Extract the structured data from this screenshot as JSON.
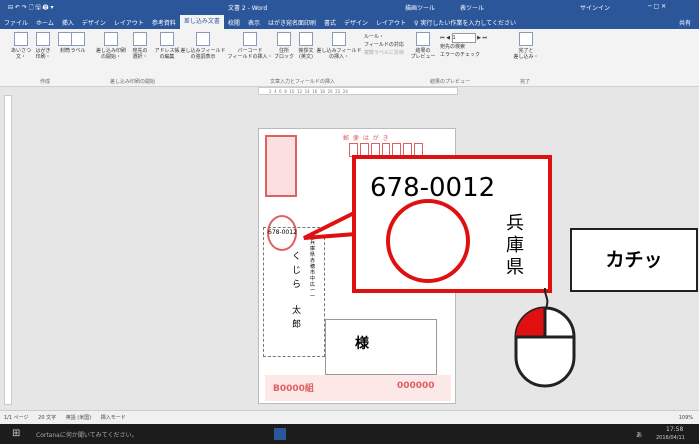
{
  "title_bar": {
    "qat": "⊟ ↶ ↷ 🗋 🖫 🖨 ▾",
    "doc_title": "文書 2 - Word",
    "context1": "描画ツール",
    "context2": "表ツール",
    "signin": "サインイン",
    "window_ctrls": "─ □ ✕"
  },
  "tabs": [
    "ファイル",
    "ホーム",
    "挿入",
    "デザイン",
    "レイアウト",
    "参考資料",
    "差し込み文書",
    "校閲",
    "表示",
    "はがき宛名面印刷",
    "書式",
    "デザイン",
    "レイアウト",
    "♀ 実行したい作業を入力してください"
  ],
  "share": "共有",
  "ribbon": {
    "buttons": [
      {
        "l1": "あいさつ",
        "l2": "文・"
      },
      {
        "l1": "はがき",
        "l2": "印刷・"
      },
      {
        "l1": "封筒",
        "l2": ""
      },
      {
        "l1": "ラベル",
        "l2": ""
      },
      {
        "l1": "差し込み印刷",
        "l2": "の開始・"
      },
      {
        "l1": "宛先の",
        "l2": "選択・"
      },
      {
        "l1": "アドレス帳",
        "l2": "の編集"
      },
      {
        "l1": "差し込みフィールド",
        "l2": "の強調表示"
      },
      {
        "l1": "バーコード",
        "l2": "フィールドの挿入・"
      },
      {
        "l1": "住所",
        "l2": "ブロック"
      },
      {
        "l1": "挨拶文",
        "l2": "(英文)"
      },
      {
        "l1": "差し込みフィールド",
        "l2": "の挿入・"
      }
    ],
    "small": [
      "ルール・",
      "フィールドの対応",
      "複数ラベルに反映",
      "宛先の検索",
      "エラーのチェック"
    ],
    "record": "1",
    "preview_btn": {
      "l1": "結果の",
      "l2": "プレビュー"
    },
    "finish_btn": {
      "l1": "完了と",
      "l2": "差し込み・"
    },
    "groups": [
      "作成",
      "差し込み印刷の開始",
      "文章入力とフィールドの挿入",
      "結果のプレビュー",
      "完了"
    ]
  },
  "ruler_numbers": "2  4  6  8  10  12  14  16  18  20  22  24",
  "card": {
    "header": "郵 便 は が き",
    "postal": "678-0012",
    "address_col": "兵庫県赤穂市中広一一",
    "name_chars": [
      "く",
      "じ",
      "ら",
      "太",
      "郎"
    ],
    "sama": "様",
    "lottery": "B0000組",
    "number": "000000"
  },
  "zoom_balloon": {
    "postal": "678-0012",
    "ken_chars": [
      "兵",
      "庫",
      "県"
    ]
  },
  "speech": "カチッ",
  "status": {
    "page": "1/1 ページ",
    "words": "20 文字",
    "lang": "英語 (米国)",
    "mode": "挿入モード",
    "zoom": "109%"
  },
  "taskbar": {
    "cortana": "Cortanaに何か聞いてみてください。",
    "time": "17:58",
    "date": "2016/04/11",
    "ime": "あ"
  }
}
